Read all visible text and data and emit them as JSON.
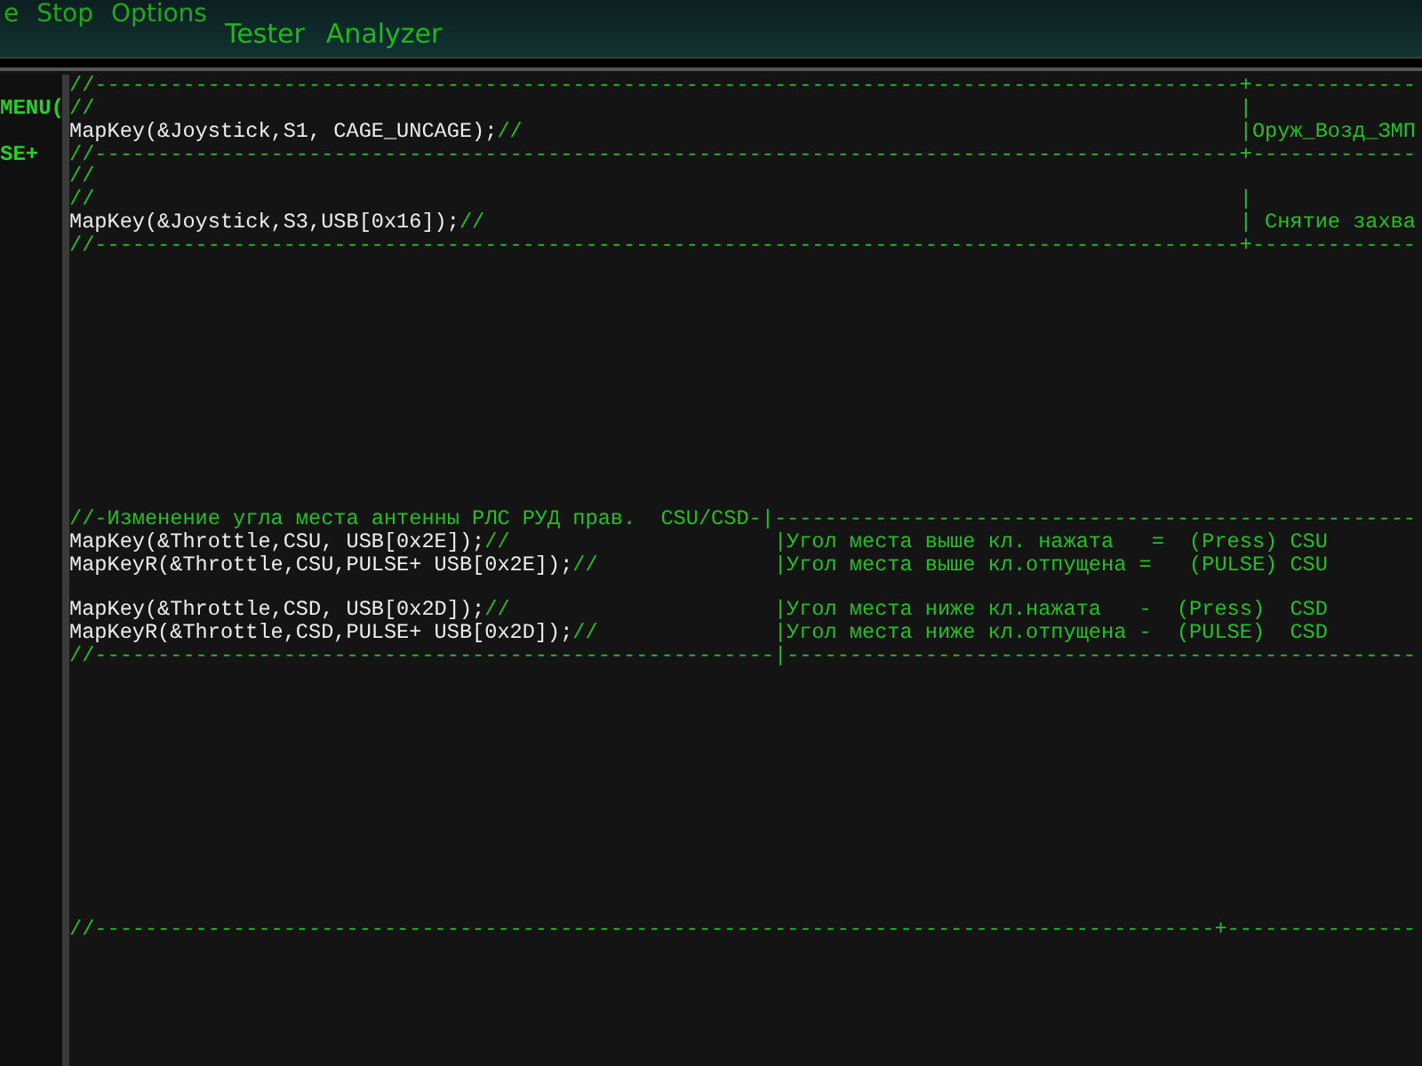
{
  "menu": [
    "e",
    "Stop",
    "Options"
  ],
  "tools": [
    "Tester",
    "Analyzer"
  ],
  "side_panel": {
    "lines": [
      {
        "kind": "blank"
      },
      {
        "kind": "text",
        "text": "MENU("
      },
      {
        "kind": "blank"
      },
      {
        "kind": "text",
        "text": "SE+"
      }
    ]
  },
  "editor": {
    "lines": [
      {
        "kind": "wide",
        "comment": "//-------------------------------------------------------------------------------------------",
        "right": "+-------------"
      },
      {
        "kind": "wide",
        "comment": "//",
        "right": "|"
      },
      {
        "kind": "wide",
        "code": "MapKey(&Joystick,S1, CAGE_UNCAGE);",
        "comment": "//",
        "right": "|Оруж_Возд_ЗМП"
      },
      {
        "kind": "wide",
        "comment": "//-------------------------------------------------------------------------------------------",
        "right": "+-------------"
      },
      {
        "kind": "full",
        "comment": "//"
      },
      {
        "kind": "wide",
        "comment": "//",
        "right": "|"
      },
      {
        "kind": "wide",
        "code": "MapKey(&Joystick,S3,USB[0x16]);",
        "comment": "//",
        "right": "| Снятие захва"
      },
      {
        "kind": "wide",
        "comment": "//-------------------------------------------------------------------------------------------",
        "right": "+-------------"
      },
      {
        "kind": "blank"
      },
      {
        "kind": "blank"
      },
      {
        "kind": "blank"
      },
      {
        "kind": "blank"
      },
      {
        "kind": "blank"
      },
      {
        "kind": "blank"
      },
      {
        "kind": "blank"
      },
      {
        "kind": "blank"
      },
      {
        "kind": "blank"
      },
      {
        "kind": "blank"
      },
      {
        "kind": "blank"
      },
      {
        "kind": "full",
        "comment": "//-Изменение угла места антенны РЛС РУД прав.  CSU/CSD-|---------------------------------------------------"
      },
      {
        "kind": "narrow",
        "code": "MapKey(&Throttle,CSU, USB[0x2E]);",
        "comment": "//",
        "right": "|Угол места выше кл. нажата   =  (Press) CSU"
      },
      {
        "kind": "narrow",
        "code": "MapKeyR(&Throttle,CSU,PULSE+ USB[0x2E]);",
        "comment": "//",
        "right": "|Угол места выше кл.отпущена =   (PULSE) CSU"
      },
      {
        "kind": "blank"
      },
      {
        "kind": "narrow",
        "code": "MapKey(&Throttle,CSD, USB[0x2D]);",
        "comment": "//",
        "right": "|Угол места ниже кл.нажата   -  (Press)  CSD"
      },
      {
        "kind": "narrow",
        "code": "MapKeyR(&Throttle,CSD,PULSE+ USB[0x2D]);",
        "comment": "//",
        "right": "|Угол места ниже кл.отпущена -  (PULSE)  CSD"
      },
      {
        "kind": "narrow",
        "comment": "//------------------------------------------------------",
        "right": "|--------------------------------------------------"
      },
      {
        "kind": "blank"
      },
      {
        "kind": "blank"
      },
      {
        "kind": "blank"
      },
      {
        "kind": "blank"
      },
      {
        "kind": "blank"
      },
      {
        "kind": "blank"
      },
      {
        "kind": "blank"
      },
      {
        "kind": "blank"
      },
      {
        "kind": "blank"
      },
      {
        "kind": "blank"
      },
      {
        "kind": "blank"
      },
      {
        "kind": "full",
        "comment": "//-----------------------------------------------------------------------------------------+---------------"
      }
    ]
  }
}
